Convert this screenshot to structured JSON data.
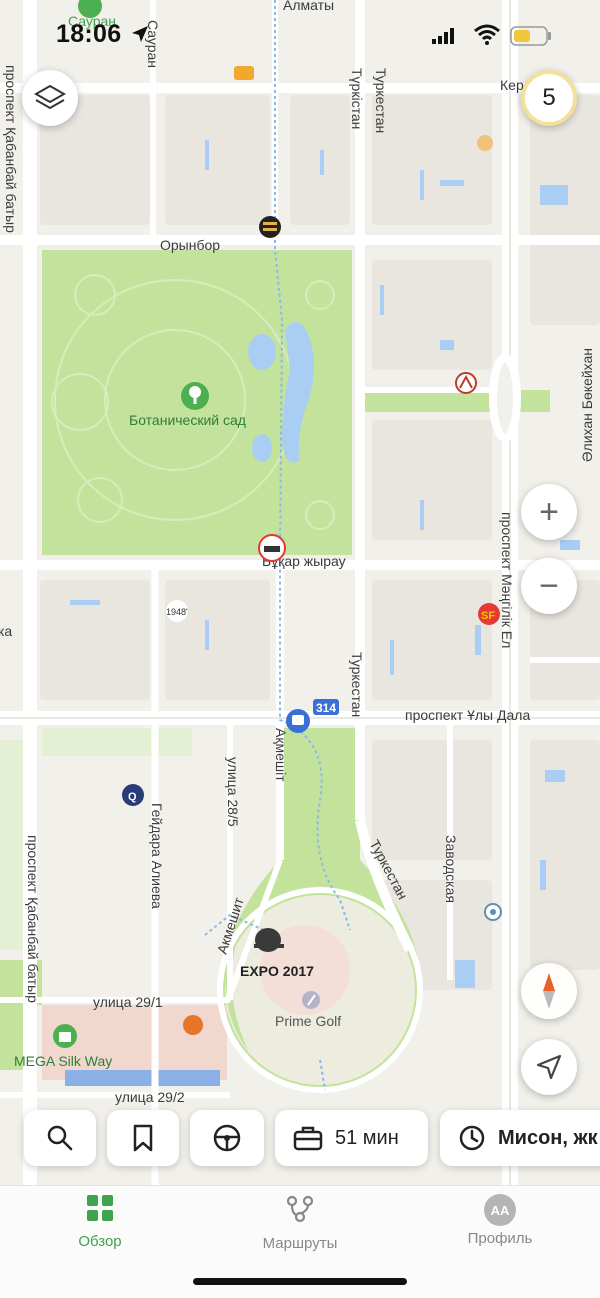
{
  "status_bar": {
    "time": "18:06"
  },
  "map": {
    "streets": {
      "almaty": "Алматы",
      "sauran_top": "Сауран",
      "sauran_vertical": "Сауран",
      "kerey": "Керей",
      "kabanbay_top": "проспект Қабанбай батыр",
      "kabanbay_bottom": "проспект Қабанбай батыр",
      "turkistan_kz": "Түркістан",
      "turkestan_top": "Туркестан",
      "orynbor": "Орынбор",
      "bukhar": "Бұқар жырау",
      "turkestan_mid": "Туркестан",
      "uly_dala": "проспект Ұлы Дала",
      "akmeshit_vertical": "Ақмешіт",
      "street_28_5": "улица 28/5",
      "heydar": "Гейдара Алиева",
      "akmeshit_curve": "Акмешит",
      "turkestan_bottom": "Туркестан",
      "zavodskaya": "Заводская",
      "bekeikhan": "Әлихан Бөкейхан",
      "mangilik": "проспект Мәңгілік Ел",
      "street_29_1": "улица 29/1",
      "street_29_2": "улица 29/2",
      "ka": "ка"
    },
    "pois": {
      "botanic": "Ботанический сад",
      "expo": "EXPO 2017",
      "prime_golf": "Prime Golf",
      "mega": "MEGA Silk Way",
      "year_badge": "1948'"
    },
    "bus_route": "314",
    "layers_badge": "5"
  },
  "controls": {
    "zoom_in": "+",
    "zoom_out": "−"
  },
  "chips": {
    "work_time": "51 мин",
    "home": "Мисон, жк"
  },
  "tabbar": {
    "overview": "Обзор",
    "routes": "Маршруты",
    "profile": "Профиль",
    "avatar_initials": "АА"
  },
  "colors": {
    "accent_green": "#3fa34d",
    "park_green": "#b9dc8b",
    "water": "#a9cdf3",
    "road": "#ffffff",
    "badge_ring": "#f5e09a"
  }
}
